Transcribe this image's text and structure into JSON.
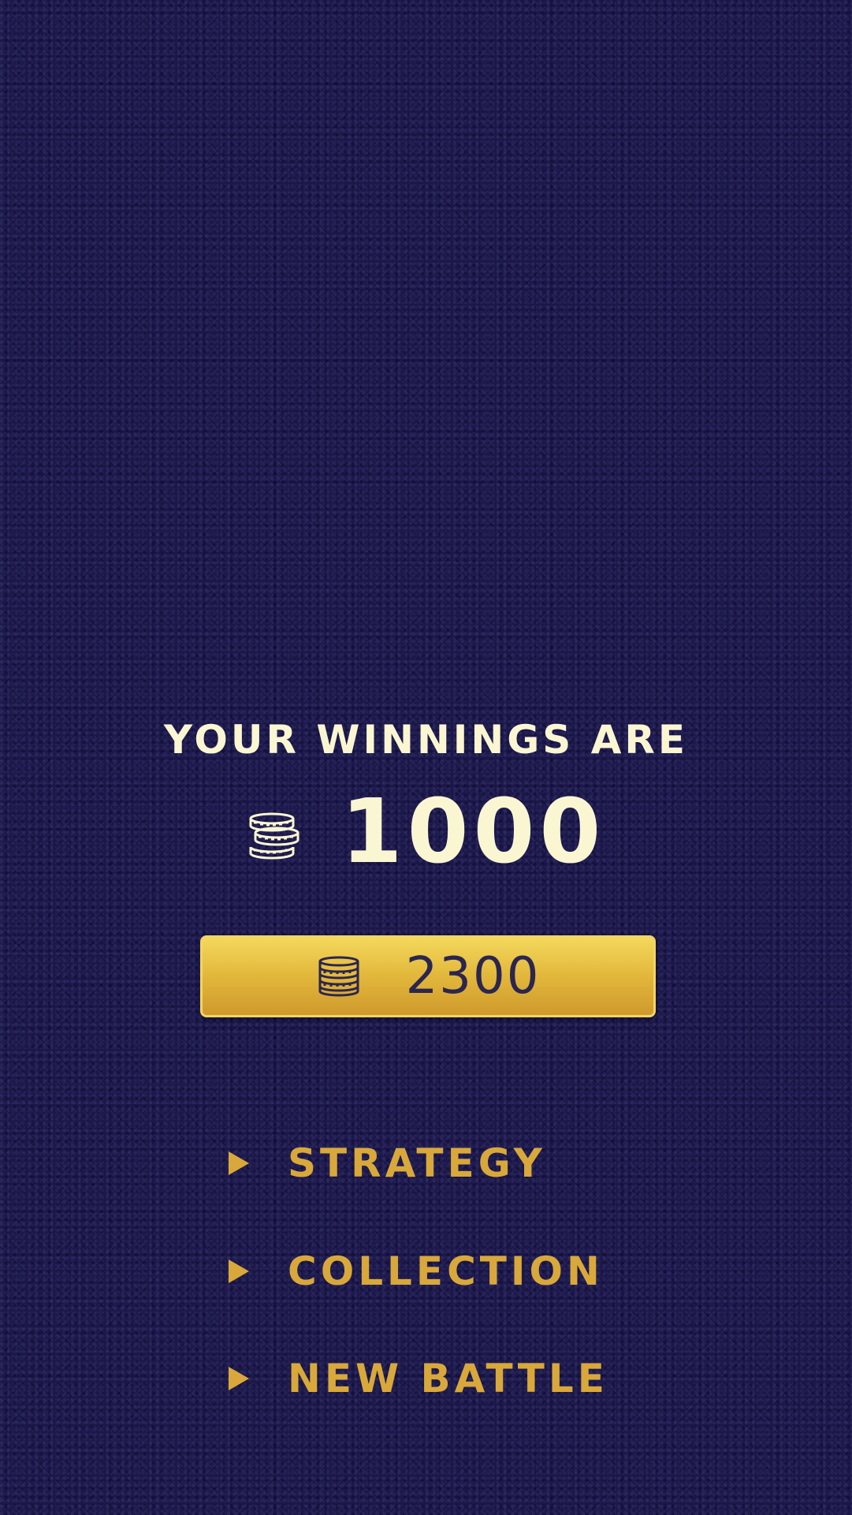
{
  "winnings": {
    "title": "YOUR WINNINGS ARE",
    "amount": "1000",
    "icon": "coin-stack-icon"
  },
  "balance": {
    "value": "2300",
    "icon": "coin-stack-icon"
  },
  "menu": {
    "items": [
      {
        "label": "STRATEGY",
        "icon": "play-arrow-icon"
      },
      {
        "label": "COLLECTION",
        "icon": "play-arrow-icon"
      },
      {
        "label": "NEW BATTLE",
        "icon": "play-arrow-icon"
      }
    ]
  },
  "colors": {
    "background": "#1b1849",
    "headline": "#fbf6d2",
    "gold": "#d9a83a",
    "button_gold": "#e2b73b",
    "button_text": "#2b2650"
  }
}
